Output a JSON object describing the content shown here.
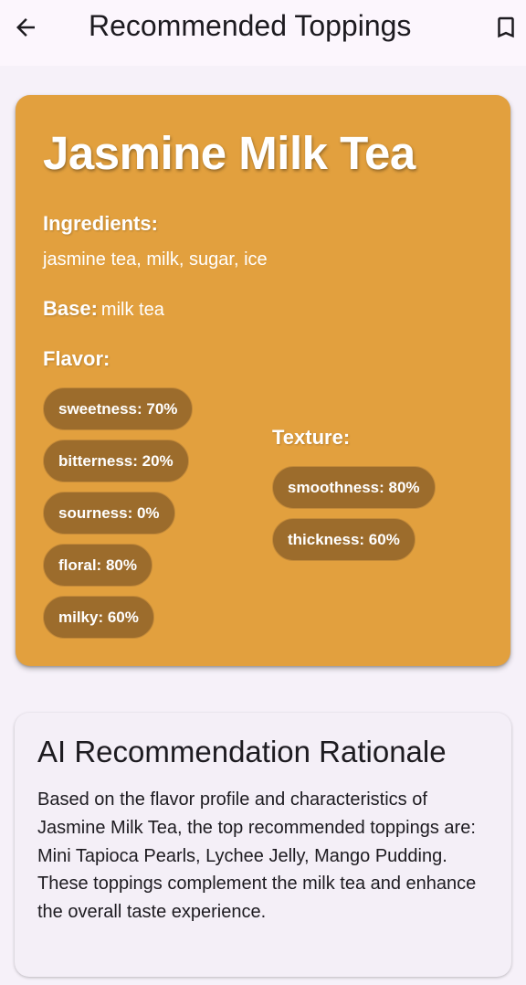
{
  "app_bar": {
    "title": "Recommended Toppings",
    "back_icon": "arrow-back-icon",
    "bookmark_icon": "bookmark-outline-icon"
  },
  "tea": {
    "name": "Jasmine Milk Tea",
    "ingredients_label": "Ingredients:",
    "ingredients": "jasmine tea, milk, sugar, ice",
    "base_label": "Base:",
    "base": "milk tea",
    "flavor_label": "Flavor:",
    "flavor": [
      "sweetness: 70%",
      "bitterness: 20%",
      "sourness: 0%",
      "floral: 80%",
      "milky: 60%"
    ],
    "texture_label": "Texture:",
    "texture": [
      "smoothness: 80%",
      "thickness: 60%"
    ]
  },
  "rationale": {
    "title": "AI Recommendation Rationale",
    "body": "Based on the flavor profile and characteristics of Jasmine Milk Tea, the top recommended toppings are: Mini Tapioca Pearls, Lychee Jelly, Mango Pudding. These toppings complement the milk tea and enhance the overall taste experience."
  },
  "colors": {
    "card_bg": "#e2a03e",
    "chip_bg": "#9c6c2c",
    "page_bg": "#f6f1f9",
    "app_bar_bg": "#fcf6fd",
    "text_dark": "#1d1b20"
  }
}
